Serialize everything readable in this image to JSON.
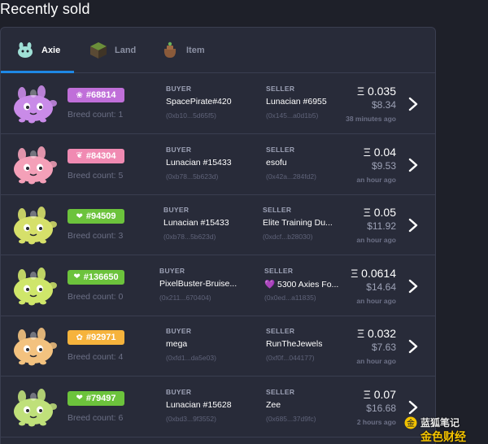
{
  "page": {
    "title": "Recently sold"
  },
  "tabs": [
    {
      "label": "Axie",
      "icon": "axie-icon",
      "active": true
    },
    {
      "label": "Land",
      "icon": "land-plot-icon",
      "active": false
    },
    {
      "label": "Item",
      "icon": "item-bag-icon",
      "active": false
    }
  ],
  "labels": {
    "buyer": "BUYER",
    "seller": "SELLER"
  },
  "sales": [
    {
      "id": "#68814",
      "class_icon": "bug-class-icon",
      "class_color": "#c06fd9",
      "breed": "Breed count: 1",
      "buyer": "SpacePirate#420",
      "buyer_addr": "(0xb10...5d65f5)",
      "seller": "Lunacian #6955",
      "seller_addr": "(0x145...a0d1b5)",
      "eth": "Ξ 0.035",
      "usd": "$8.34",
      "time": "38 minutes ago",
      "axie_color": "#c98be8"
    },
    {
      "id": "#84304",
      "class_icon": "bird-class-icon",
      "class_color": "#f08ab2",
      "breed": "Breed count: 5",
      "buyer": "Lunacian #15433",
      "buyer_addr": "(0xb78...5b623d)",
      "seller": "esofu",
      "seller_addr": "(0x42a...284fd2)",
      "eth": "Ξ 0.04",
      "usd": "$9.53",
      "time": "an hour ago",
      "axie_color": "#f4a0b8"
    },
    {
      "id": "#94509",
      "class_icon": "plant-class-icon",
      "class_color": "#6cc33c",
      "breed": "Breed count: 3",
      "buyer": "Lunacian #15433",
      "buyer_addr": "(0xb78...5b623d)",
      "seller": "Elite Training Du...",
      "seller_addr": "(0xdcf...b28030)",
      "eth": "Ξ 0.05",
      "usd": "$11.92",
      "time": "an hour ago",
      "axie_color": "#d6e06a"
    },
    {
      "id": "#136650",
      "class_icon": "plant-class-icon",
      "class_color": "#6cc33c",
      "breed": "Breed count: 0",
      "buyer": "PixelBuster-Bruise...",
      "buyer_addr": "(0x211...670404)",
      "seller": "💜 5300 Axies Fo...",
      "seller_addr": "(0x0ed...a11835)",
      "eth": "Ξ 0.0614",
      "usd": "$14.64",
      "time": "an hour ago",
      "axie_color": "#cfe66a"
    },
    {
      "id": "#92971",
      "class_icon": "beast-class-icon",
      "class_color": "#f6b33c",
      "breed": "Breed count: 4",
      "buyer": "mega",
      "buyer_addr": "(0xfd1...da5e03)",
      "seller": "RunTheJewels",
      "seller_addr": "(0xf0f...044177)",
      "eth": "Ξ 0.032",
      "usd": "$7.63",
      "time": "an hour ago",
      "axie_color": "#f3c27f"
    },
    {
      "id": "#79497",
      "class_icon": "plant-class-icon",
      "class_color": "#6cc33c",
      "breed": "Breed count: 6",
      "buyer": "Lunacian #15628",
      "buyer_addr": "(0xbd3...9f3552)",
      "seller": "Zee",
      "seller_addr": "(0x685...37d9fc)",
      "eth": "Ξ 0.07",
      "usd": "$16.68",
      "time": "2 hours ago",
      "axie_color": "#bfe07a"
    }
  ],
  "watermark": {
    "line1": "蓝狐笔记",
    "line2": "金色财经"
  }
}
